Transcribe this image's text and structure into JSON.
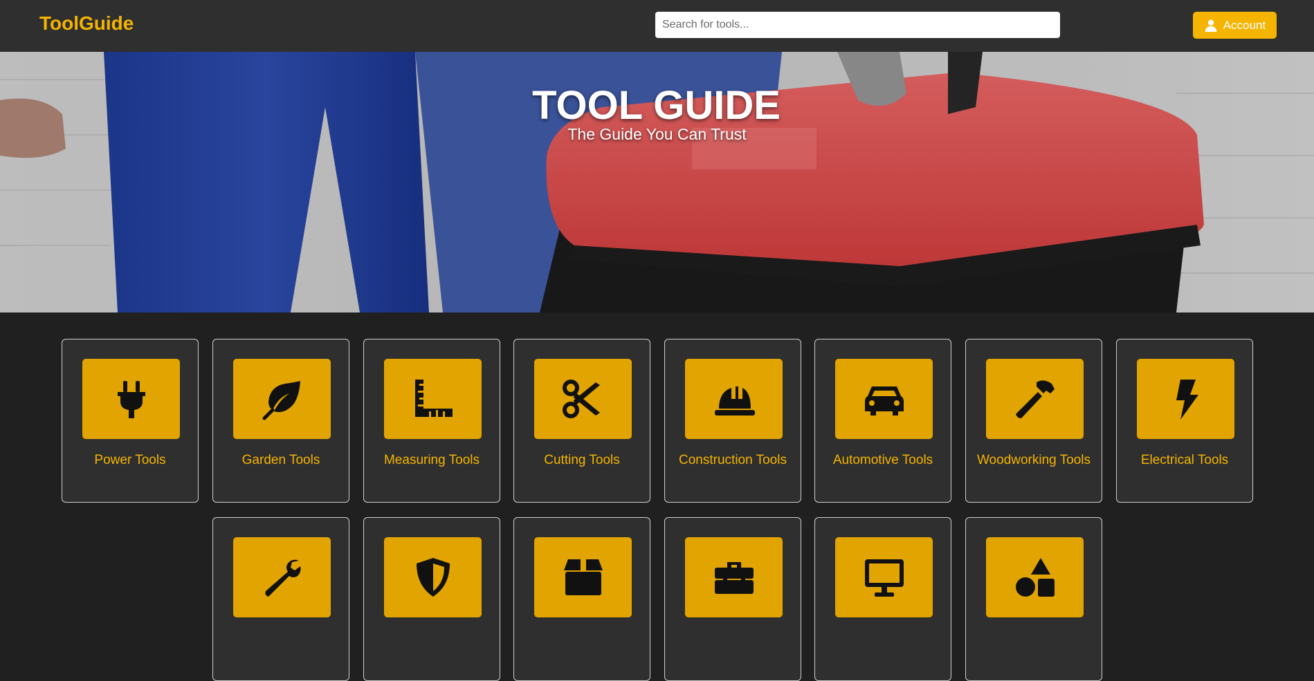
{
  "header": {
    "logo": "ToolGuide",
    "search_placeholder": "Search for tools...",
    "account_label": "Account"
  },
  "hero": {
    "title": "TOOL GUIDE",
    "subtitle": "The Guide You Can Trust"
  },
  "categories": [
    {
      "label": "Power Tools",
      "icon": "plug-icon"
    },
    {
      "label": "Garden Tools",
      "icon": "leaf-icon"
    },
    {
      "label": "Measuring Tools",
      "icon": "ruler-icon"
    },
    {
      "label": "Cutting Tools",
      "icon": "scissors-icon"
    },
    {
      "label": "Construction Tools",
      "icon": "hard-hat-icon"
    },
    {
      "label": "Automotive Tools",
      "icon": "car-icon"
    },
    {
      "label": "Woodworking Tools",
      "icon": "hammer-icon"
    },
    {
      "label": "Electrical Tools",
      "icon": "lightning-icon"
    },
    {
      "label": "",
      "icon": "wrench-icon"
    },
    {
      "label": "",
      "icon": "shield-icon"
    },
    {
      "label": "",
      "icon": "box-icon"
    },
    {
      "label": "",
      "icon": "toolbox-icon"
    },
    {
      "label": "",
      "icon": "monitor-icon"
    },
    {
      "label": "",
      "icon": "shapes-icon"
    }
  ],
  "colors": {
    "accent": "#f5b400",
    "tile": "#e2a400",
    "header_bg": "#2f2f2f",
    "page_bg": "#202020"
  }
}
